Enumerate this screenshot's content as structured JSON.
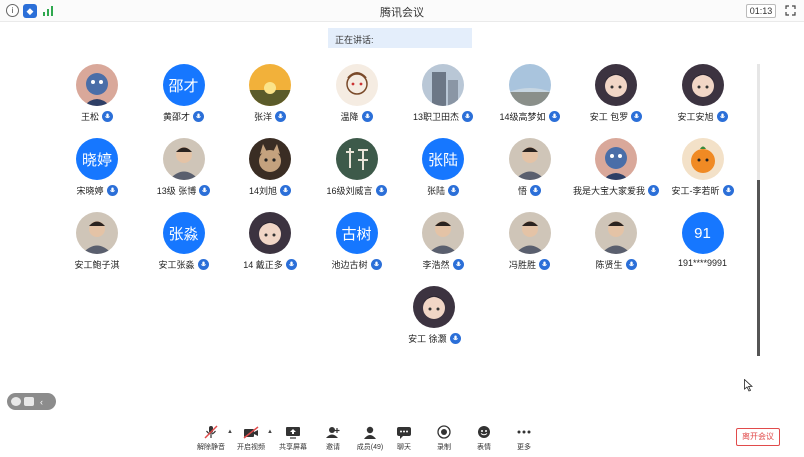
{
  "window": {
    "title": "腾讯会议",
    "timer": "01:13",
    "icons": [
      "info-icon",
      "shield-icon",
      "signal-icon",
      "fullscreen-icon"
    ],
    "info_glyph": "i",
    "shield_glyph": "◆"
  },
  "speaking": {
    "label": "正在讲话:"
  },
  "colors": {
    "accent": "#1677ff",
    "mic": "#2b6fd8",
    "leave": "#e14b4b",
    "banner": "#e4eefb"
  },
  "participants": [
    {
      "name": "王松",
      "avatar_text": "",
      "avatar_icon": "cartoon-avatar",
      "mic": "unmuted"
    },
    {
      "name": "黄邵才",
      "avatar_text": "邵才",
      "avatar_icon": "",
      "mic": "unmuted"
    },
    {
      "name": "张洋",
      "avatar_text": "",
      "avatar_icon": "sunset-photo",
      "mic": "unmuted"
    },
    {
      "name": "温降",
      "avatar_text": "",
      "avatar_icon": "sketch-avatar",
      "mic": "unmuted"
    },
    {
      "name": "13职卫田杰",
      "avatar_text": "",
      "avatar_icon": "building-photo",
      "mic": "unmuted"
    },
    {
      "name": "14级高梦如",
      "avatar_text": "",
      "avatar_icon": "sky-photo",
      "mic": "unmuted"
    },
    {
      "name": "安工 包罗",
      "avatar_text": "",
      "avatar_icon": "anime-avatar",
      "mic": "unmuted"
    },
    {
      "name": "安工安旭",
      "avatar_text": "",
      "avatar_icon": "anime-avatar",
      "mic": "unmuted"
    },
    {
      "name": "宋晓婷",
      "avatar_text": "晓婷",
      "avatar_icon": "",
      "mic": "unmuted"
    },
    {
      "name": "13级 张博",
      "avatar_text": "",
      "avatar_icon": "person-photo",
      "mic": "unmuted"
    },
    {
      "name": "14刘旭",
      "avatar_text": "",
      "avatar_icon": "cat-photo",
      "mic": "unmuted"
    },
    {
      "name": "16级刘威言",
      "avatar_text": "",
      "avatar_icon": "calligraphy-avatar",
      "mic": "unmuted"
    },
    {
      "name": "张陆",
      "avatar_text": "张陆",
      "avatar_icon": "",
      "mic": "unmuted"
    },
    {
      "name": "悟",
      "avatar_text": "",
      "avatar_icon": "person-photo",
      "mic": "unmuted"
    },
    {
      "name": "我是大宝大家爱我",
      "avatar_text": "",
      "avatar_icon": "cartoon-avatar",
      "mic": "unmuted"
    },
    {
      "name": "安工-李若昕",
      "avatar_text": "",
      "avatar_icon": "fruit-avatar",
      "mic": "unmuted"
    },
    {
      "name": "安工鲍子淇",
      "avatar_text": "",
      "avatar_icon": "person-photo",
      "mic": "none"
    },
    {
      "name": "安工张淼",
      "avatar_text": "张淼",
      "avatar_icon": "",
      "mic": "unmuted"
    },
    {
      "name": "14 戴正多",
      "avatar_text": "",
      "avatar_icon": "anime-avatar",
      "mic": "unmuted"
    },
    {
      "name": "池边古树",
      "avatar_text": "古树",
      "avatar_icon": "",
      "mic": "unmuted"
    },
    {
      "name": "李浩然",
      "avatar_text": "",
      "avatar_icon": "person-photo",
      "mic": "unmuted"
    },
    {
      "name": "冯胜胜",
      "avatar_text": "",
      "avatar_icon": "person-photo",
      "mic": "unmuted"
    },
    {
      "name": "陈贤生",
      "avatar_text": "",
      "avatar_icon": "person-photo",
      "mic": "unmuted"
    },
    {
      "name": "191****9991",
      "avatar_text": "91",
      "avatar_icon": "",
      "mic": "none"
    },
    {
      "name": "安工 徐灏",
      "avatar_text": "",
      "avatar_icon": "anime-avatar",
      "mic": "unmuted"
    }
  ],
  "side_panel": {
    "icons": [
      "emoji-icon",
      "chat-icon"
    ],
    "toggle": "‹"
  },
  "toolbar": {
    "items": [
      {
        "label": "解除静音",
        "icon": "mic-muted-icon",
        "has_caret": true
      },
      {
        "label": "开启视频",
        "icon": "camera-off-icon",
        "has_caret": true
      },
      {
        "label": "共享屏幕",
        "icon": "share-screen-icon",
        "has_caret": false
      },
      {
        "label": "邀请",
        "icon": "invite-icon",
        "has_caret": false
      },
      {
        "label": "成员(49)",
        "icon": "members-icon",
        "has_caret": false
      },
      {
        "label": "聊天",
        "icon": "chat-icon",
        "has_caret": false
      },
      {
        "label": "录制",
        "icon": "record-icon",
        "has_caret": false
      },
      {
        "label": "表情",
        "icon": "emoji-icon",
        "has_caret": false
      },
      {
        "label": "更多",
        "icon": "more-icon",
        "has_caret": false
      }
    ],
    "caret_glyph": "▲",
    "leave_label": "离开会议"
  }
}
